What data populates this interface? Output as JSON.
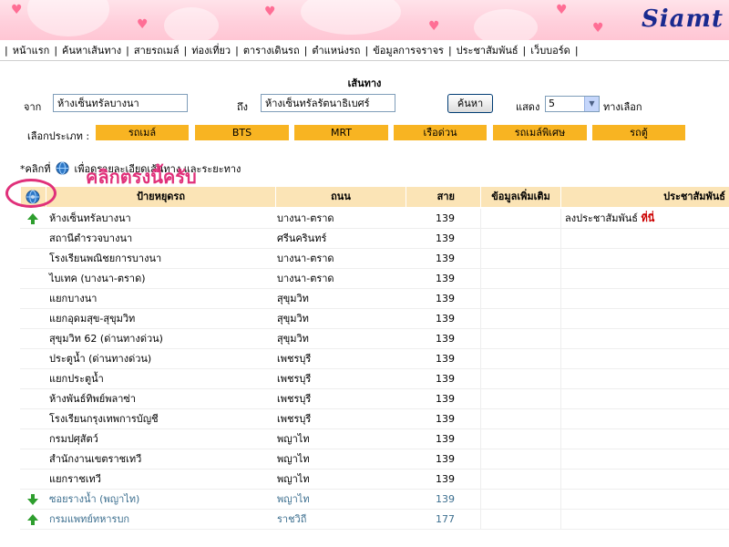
{
  "logo": "Siamt",
  "nav": [
    "หน้าแรก",
    "ค้นหาเส้นทาง",
    "สายรถเมล์",
    "ท่องเที่ยว",
    "ตารางเดินรถ",
    "ตำแหน่งรถ",
    "ข้อมูลการจราจร",
    "ประชาสัมพันธ์",
    "เว็บบอร์ด"
  ],
  "section_title": "เส้นทาง",
  "search": {
    "from_label": "จาก",
    "from_value": "ห้างเซ็นทรัลบางนา",
    "to_label": "ถึง",
    "to_value": "ห้างเซ็นทรัลรัตนาธิเบศร์",
    "button": "ค้นหา",
    "show_label": "แสดง",
    "show_value": "5",
    "options_label": "ทางเลือก"
  },
  "vehicle": {
    "label": "เลือกประเภท :",
    "modes": [
      "รถเมล์",
      "BTS",
      "MRT",
      "เรือด่วน",
      "รถเมล์พิเศษ",
      "รถตู้"
    ]
  },
  "hint": {
    "prefix": "*คลิกที่",
    "suffix": "เพื่อดูรายละเอียดเส้นทาง และระยะทาง"
  },
  "overlay_text": "คลิกตรงนี้ครับ",
  "table": {
    "headers": [
      "ป้ายหยุดรถ",
      "ถนน",
      "สาย",
      "ข้อมูลเพิ่มเติม",
      "ประชาสัมพันธ์"
    ],
    "rows": [
      {
        "icon": "up",
        "stop": "ห้างเซ็นทรัลบางนา",
        "road": "บางนา-ตราด",
        "line": "139",
        "extra": "",
        "promo": "ลงประชาสัมพันธ์",
        "promo_link": "ที่นี่",
        "dim": false
      },
      {
        "icon": "",
        "stop": "สถานีตำรวจบางนา",
        "road": "ศรีนครินทร์",
        "line": "139",
        "extra": "",
        "promo": "",
        "promo_link": "",
        "dim": false
      },
      {
        "icon": "",
        "stop": "โรงเรียนพณิชยการบางนา",
        "road": "บางนา-ตราด",
        "line": "139",
        "extra": "",
        "promo": "",
        "promo_link": "",
        "dim": false
      },
      {
        "icon": "",
        "stop": "ไบเทค (บางนา-ตราด)",
        "road": "บางนา-ตราด",
        "line": "139",
        "extra": "",
        "promo": "",
        "promo_link": "",
        "dim": false
      },
      {
        "icon": "",
        "stop": "แยกบางนา",
        "road": "สุขุมวิท",
        "line": "139",
        "extra": "",
        "promo": "",
        "promo_link": "",
        "dim": false
      },
      {
        "icon": "",
        "stop": "แยกอุดมสุข-สุขุมวิท",
        "road": "สุขุมวิท",
        "line": "139",
        "extra": "",
        "promo": "",
        "promo_link": "",
        "dim": false
      },
      {
        "icon": "",
        "stop": "สุขุมวิท 62 (ด่านทางด่วน)",
        "road": "สุขุมวิท",
        "line": "139",
        "extra": "",
        "promo": "",
        "promo_link": "",
        "dim": false
      },
      {
        "icon": "",
        "stop": "ประตูน้ำ (ด่านทางด่วน)",
        "road": "เพชรบุรี",
        "line": "139",
        "extra": "",
        "promo": "",
        "promo_link": "",
        "dim": false
      },
      {
        "icon": "",
        "stop": "แยกประตูน้ำ",
        "road": "เพชรบุรี",
        "line": "139",
        "extra": "",
        "promo": "",
        "promo_link": "",
        "dim": false
      },
      {
        "icon": "",
        "stop": "ห้างพันธ์ทิพย์พลาซ่า",
        "road": "เพชรบุรี",
        "line": "139",
        "extra": "",
        "promo": "",
        "promo_link": "",
        "dim": false
      },
      {
        "icon": "",
        "stop": "โรงเรียนกรุงเทพการบัญชี",
        "road": "เพชรบุรี",
        "line": "139",
        "extra": "",
        "promo": "",
        "promo_link": "",
        "dim": false
      },
      {
        "icon": "",
        "stop": "กรมปศุสัตว์",
        "road": "พญาไท",
        "line": "139",
        "extra": "",
        "promo": "",
        "promo_link": "",
        "dim": false
      },
      {
        "icon": "",
        "stop": "สำนักงานเขตราชเทวี",
        "road": "พญาไท",
        "line": "139",
        "extra": "",
        "promo": "",
        "promo_link": "",
        "dim": false
      },
      {
        "icon": "",
        "stop": "แยกราชเทวี",
        "road": "พญาไท",
        "line": "139",
        "extra": "",
        "promo": "",
        "promo_link": "",
        "dim": false
      },
      {
        "icon": "down",
        "stop": "ซอยรางน้ำ (พญาไท)",
        "road": "พญาไท",
        "line": "139",
        "extra": "",
        "promo": "",
        "promo_link": "",
        "dim": true
      },
      {
        "icon": "up",
        "stop": "กรมแพทย์ทหารบก",
        "road": "ราชวิถี",
        "line": "177",
        "extra": "",
        "promo": "",
        "promo_link": "",
        "dim": true
      }
    ]
  },
  "colors": {
    "header_pink": "#ffd0dc",
    "mode_button": "#f8b422",
    "table_header": "#fbe4b6",
    "overlay": "#e0307a",
    "link_red": "#cc0000",
    "arrow_green": "#2e9e2e"
  }
}
